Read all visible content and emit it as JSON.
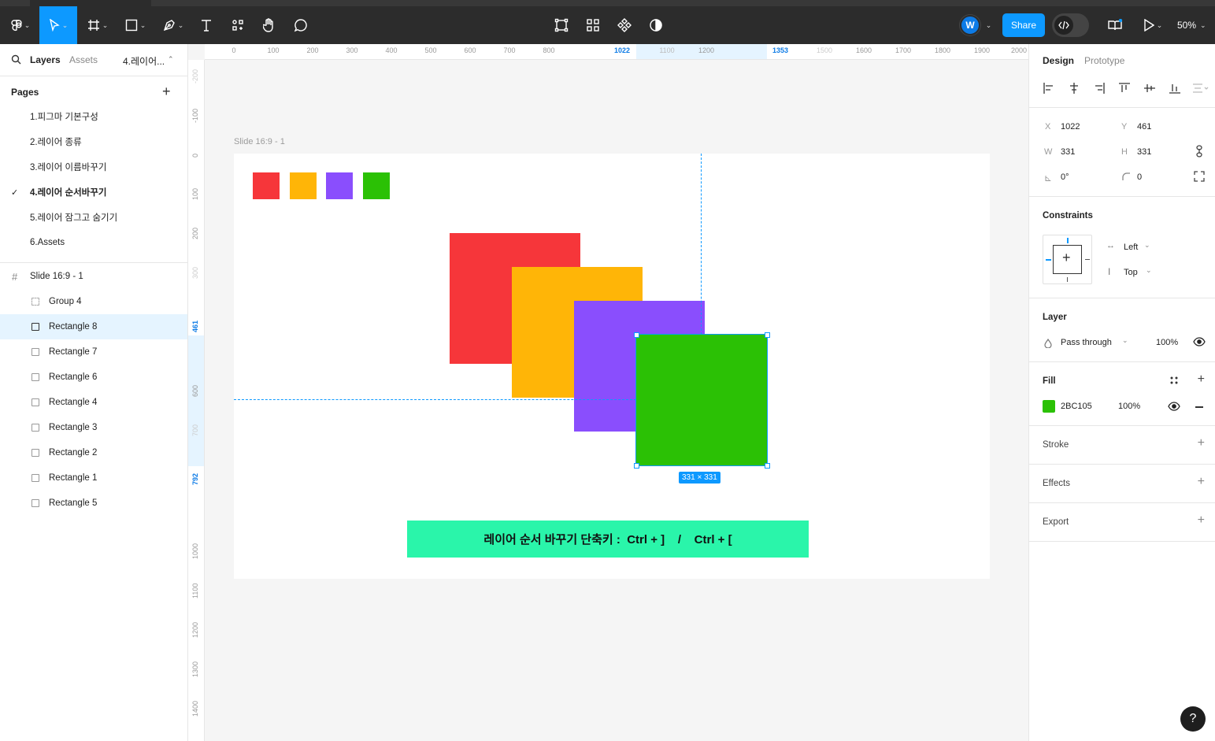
{
  "toolbar": {
    "zoom": "50%",
    "share_label": "Share",
    "avatar_initial": "W"
  },
  "left_panel": {
    "tabs": {
      "layers": "Layers",
      "assets": "Assets",
      "current_page": "4.레이어..."
    },
    "pages_title": "Pages",
    "pages": [
      {
        "label": "1.피그마 기본구성"
      },
      {
        "label": "2.레이어 종류"
      },
      {
        "label": "3.레이어 이름바꾸기"
      },
      {
        "label": "4.레이어 순서바꾸기",
        "active": true
      },
      {
        "label": "5.레이어 잠그고 숨기기"
      },
      {
        "label": "6.Assets"
      }
    ],
    "layers": [
      {
        "label": "Slide 16:9 - 1"
      },
      {
        "label": "Group 4"
      },
      {
        "label": "Rectangle 8",
        "selected": true
      },
      {
        "label": "Rectangle 7"
      },
      {
        "label": "Rectangle 6"
      },
      {
        "label": "Rectangle 4"
      },
      {
        "label": "Rectangle 3"
      },
      {
        "label": "Rectangle 2"
      },
      {
        "label": "Rectangle 1"
      },
      {
        "label": "Rectangle 5"
      }
    ]
  },
  "rulers": {
    "top": [
      "0",
      "100",
      "200",
      "300",
      "400",
      "500",
      "600",
      "700",
      "800",
      "1022",
      "1100",
      "1200",
      "1353",
      "1500",
      "1600",
      "1700",
      "1800",
      "1900",
      "2000"
    ],
    "left": [
      "-200",
      "-100",
      "0",
      "100",
      "200",
      "300",
      "461",
      "600",
      "700",
      "792",
      "1000",
      "1100",
      "1200",
      "1300",
      "1400"
    ]
  },
  "canvas": {
    "frame_label": "Slide 16:9 - 1",
    "banner_text": "레이어 순서 바꾸기 단축키 :  Ctrl + ]    /    Ctrl + [",
    "dimension_tag": "331 × 331",
    "colors": {
      "red": "#f6363a",
      "yellow": "#ffb507",
      "purple": "#8a4efd",
      "green": "#2bc105",
      "banner": "#2af5aa"
    }
  },
  "right_panel": {
    "tabs": {
      "design": "Design",
      "prototype": "Prototype"
    },
    "x_label": "X",
    "x": "1022",
    "y_label": "Y",
    "y": "461",
    "w_label": "W",
    "w": "331",
    "h_label": "H",
    "h": "331",
    "rotation": "0°",
    "radius": "0",
    "constraints_title": "Constraints",
    "constraint_h": "Left",
    "constraint_v": "Top",
    "layer_title": "Layer",
    "blend_mode": "Pass through",
    "layer_opacity": "100%",
    "fill_title": "Fill",
    "fill_hex": "2BC105",
    "fill_opacity": "100%",
    "fill_color": "#2bc105",
    "stroke_title": "Stroke",
    "effects_title": "Effects",
    "export_title": "Export"
  },
  "help": "?"
}
